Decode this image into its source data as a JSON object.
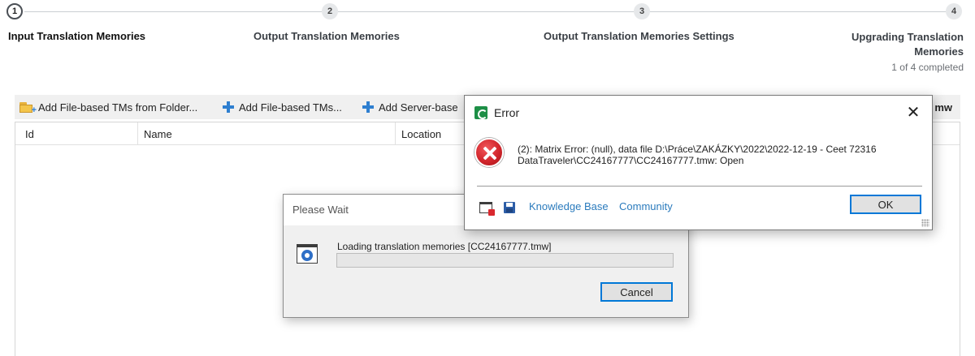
{
  "wizard": {
    "steps": [
      {
        "number": "1",
        "label": "Input Translation Memories",
        "state": "active"
      },
      {
        "number": "2",
        "label": "Output Translation Memories",
        "state": "pending"
      },
      {
        "number": "3",
        "label": "Output Translation Memories Settings",
        "state": "pending"
      },
      {
        "number": "4",
        "label": "Upgrading Translation Memories",
        "state": "pending"
      }
    ],
    "status": "1 of 4 completed"
  },
  "toolbar": {
    "add_from_folder": "Add File-based TMs from Folder...",
    "add_file_based": "Add File-based TMs...",
    "add_server_based": "Add Server-base",
    "right_text": "mw"
  },
  "grid": {
    "columns": [
      "Id",
      "Name",
      "Location"
    ]
  },
  "wait_dialog": {
    "title": "Please Wait",
    "message": "Loading translation memories [CC24167777.tmw]",
    "progress_percent": 0,
    "cancel_label": "Cancel"
  },
  "error_dialog": {
    "title": "Error",
    "close_glyph": "✕",
    "message_line1": "(2): Matrix Error: (null), data file D:\\Práce\\ZAKÁZKY\\2022\\2022-12-19 - Ceet 72316",
    "message_line2": "DataTraveler\\CC24167777\\CC24167777.tmw: Open",
    "link_knowledge_base": "Knowledge Base",
    "link_community": "Community",
    "ok_label": "OK"
  },
  "colors": {
    "link": "#2b7bbd",
    "plus_icon": "#2e7fd0",
    "error_red": "#d2262c",
    "default_button_border": "#0078d7"
  }
}
